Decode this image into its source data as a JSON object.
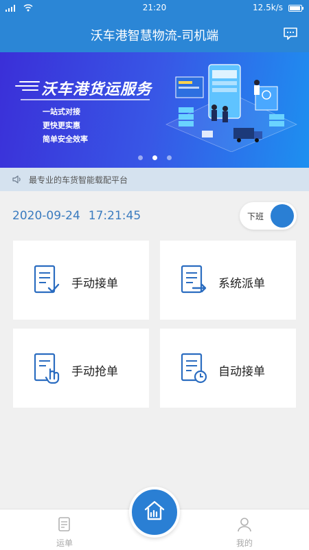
{
  "status_bar": {
    "time": "21:20",
    "net_speed": "12.5k/s"
  },
  "header": {
    "title": "沃车港智慧物流-司机端",
    "message_icon": "chat-bubble-icon"
  },
  "banner": {
    "headline": "沃车港货运服务",
    "lines": [
      "一站式对接",
      "更快更实惠",
      "简单安全效率"
    ],
    "slide_count": 3,
    "active_slide": 2
  },
  "notice": {
    "icon": "speaker-icon",
    "text": "最专业的车货智能载配平台"
  },
  "datetime": {
    "date": "2020-09-24",
    "time": "17:21:45"
  },
  "shift_toggle": {
    "label": "下班"
  },
  "cards": [
    {
      "label": "手动接单",
      "icon": "document-check-icon"
    },
    {
      "label": "系统派单",
      "icon": "document-arrow-icon"
    },
    {
      "label": "手动抢单",
      "icon": "document-tap-icon"
    },
    {
      "label": "自动接单",
      "icon": "document-clock-icon"
    }
  ],
  "tabbar": {
    "items": [
      {
        "label": "运单",
        "icon": "waybill-icon"
      },
      {
        "label": "我的",
        "icon": "user-icon"
      }
    ],
    "center_icon": "home-icon"
  },
  "colors": {
    "primary": "#2b86d6",
    "accent_blue": "#2a7fd4",
    "notice_bg": "#d5e2ef",
    "date_text": "#3a7bbf",
    "icon_blue": "#2a6cc0"
  }
}
